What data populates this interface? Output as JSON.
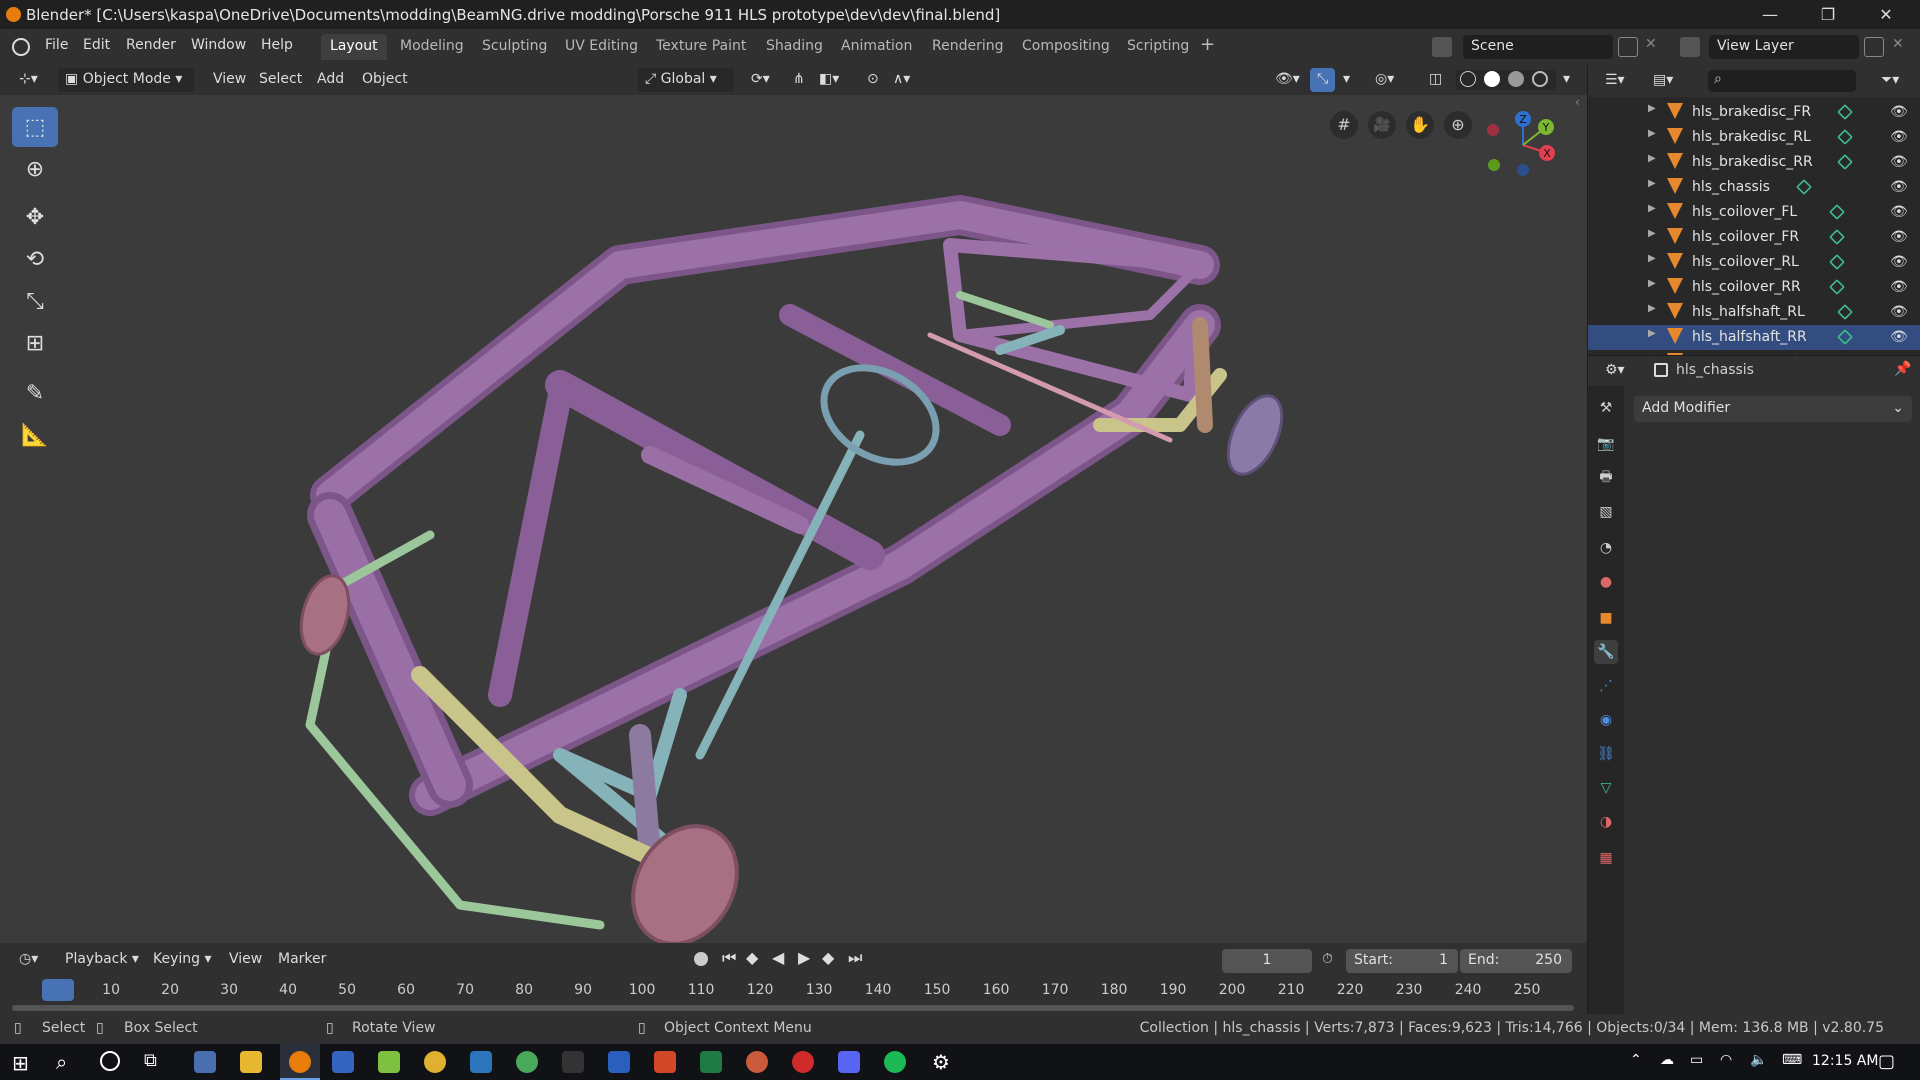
{
  "window": {
    "title": "Blender* [C:\\Users\\kaspa\\OneDrive\\Documents\\modding\\BeamNG.drive modding\\Porsche 911 HLS prototype\\dev\\dev\\final.blend]",
    "controls": [
      "—",
      "❐",
      "✕"
    ]
  },
  "menu": [
    "File",
    "Edit",
    "Render",
    "Window",
    "Help"
  ],
  "workspaces": [
    "Layout",
    "Modeling",
    "Sculpting",
    "UV Editing",
    "Texture Paint",
    "Shading",
    "Animation",
    "Rendering",
    "Compositing",
    "Scripting"
  ],
  "scene": "Scene",
  "view_layer": "View Layer",
  "viewport_header": {
    "mode": "Object Mode",
    "menus": [
      "View",
      "Select",
      "Add",
      "Object"
    ],
    "transform": "Global"
  },
  "outliner": {
    "items": [
      {
        "name": "hls_brakedisc_FR",
        "selected": false
      },
      {
        "name": "hls_brakedisc_RL",
        "selected": false
      },
      {
        "name": "hls_brakedisc_RR",
        "selected": false
      },
      {
        "name": "hls_chassis",
        "selected": false
      },
      {
        "name": "hls_coilover_FL",
        "selected": false
      },
      {
        "name": "hls_coilover_FR",
        "selected": false
      },
      {
        "name": "hls_coilover_RL",
        "selected": false
      },
      {
        "name": "hls_coilover_RR",
        "selected": false
      },
      {
        "name": "hls_halfshaft_RL",
        "selected": false
      },
      {
        "name": "hls_halfshaft_RR",
        "selected": true
      },
      {
        "name": "hls_hub_FL",
        "selected": false
      }
    ]
  },
  "properties": {
    "object_name": "hls_chassis",
    "add_modifier": "Add Modifier",
    "active_tab": "modifier"
  },
  "timeline": {
    "menus": [
      "Playback",
      "Keying",
      "View",
      "Marker"
    ],
    "current_frame": "1",
    "start_label": "Start:",
    "start": "1",
    "end_label": "End:",
    "end": "250",
    "ruler": [
      "1",
      "10",
      "20",
      "30",
      "40",
      "50",
      "60",
      "70",
      "80",
      "90",
      "100",
      "110",
      "120",
      "130",
      "140",
      "150",
      "160",
      "170",
      "180",
      "190",
      "200",
      "210",
      "220",
      "230",
      "240",
      "250"
    ]
  },
  "status": {
    "select": "Select",
    "box_select": "Box Select",
    "rotate_view": "Rotate View",
    "context_menu": "Object Context Menu",
    "stats": "Collection | hls_chassis | Verts:7,873 | Faces:9,623 | Tris:14,766 | Objects:0/34 | Mem: 136.8 MB | v2.80.75"
  },
  "taskbar": {
    "time": "12:15 AM"
  },
  "colors": {
    "frame": "#9a6fa6",
    "frame_dark": "#6e4a7b",
    "teal": "#86b2ba",
    "green": "#9bc79b",
    "yellow": "#c8c48a",
    "disc": "#a87083",
    "accent": "#4772b3"
  }
}
